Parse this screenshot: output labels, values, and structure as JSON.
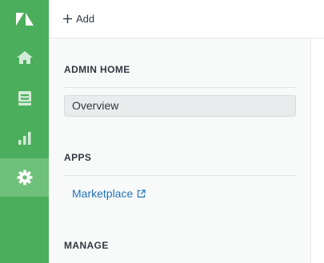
{
  "topbar": {
    "add_label": "Add"
  },
  "rail": {
    "items": [
      {
        "icon": "zendesk-logo-icon"
      },
      {
        "icon": "home-icon"
      },
      {
        "icon": "views-inbox-icon"
      },
      {
        "icon": "reporting-bar-chart-icon"
      },
      {
        "icon": "admin-gear-icon",
        "active": true
      }
    ]
  },
  "panel": {
    "admin_home": {
      "title": "ADMIN HOME",
      "items": [
        {
          "label": "Overview",
          "selected": true
        }
      ]
    },
    "apps": {
      "title": "APPS",
      "items": [
        {
          "label": "Marketplace",
          "external": true
        }
      ]
    },
    "manage": {
      "title": "MANAGE"
    }
  },
  "colors": {
    "rail_bg": "#4bae5c",
    "rail_active": "#6ec07a",
    "link": "#1f73b7",
    "panel_bg": "#f8f9f9"
  }
}
